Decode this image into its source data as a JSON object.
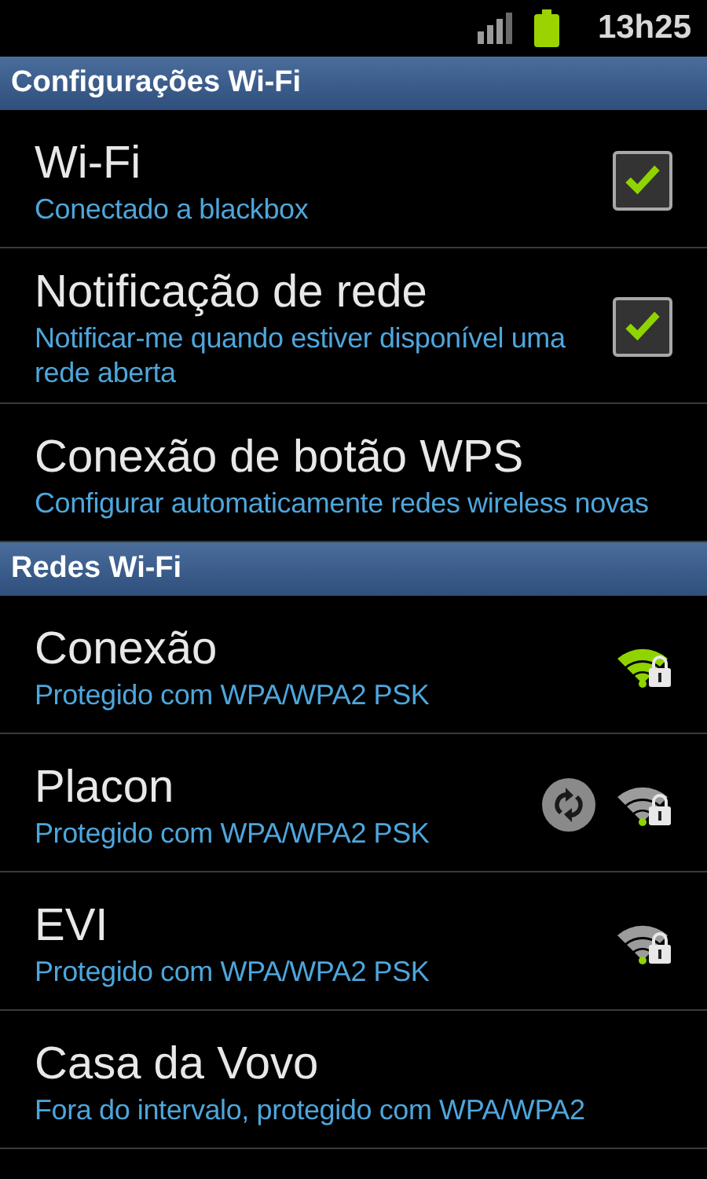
{
  "status_bar": {
    "time": "13h25"
  },
  "sections": [
    {
      "header": "Configurações Wi-Fi",
      "items": [
        {
          "kind": "checkbox",
          "title": "Wi-Fi",
          "summary": "Conectado a blackbox",
          "checked": true
        },
        {
          "kind": "checkbox",
          "title": "Notificação de rede",
          "summary": "Notificar-me quando estiver disponível uma rede aberta",
          "checked": true
        },
        {
          "kind": "plain",
          "title": "Conexão de botão WPS",
          "summary": "Configurar automaticamente redes wireless novas"
        }
      ]
    },
    {
      "header": "Redes Wi-Fi",
      "items": [
        {
          "kind": "network",
          "title": "Conexão",
          "summary": "Protegido com WPA/WPA2 PSK",
          "strong": true,
          "in_range": true,
          "wps": false
        },
        {
          "kind": "network",
          "title": "Placon",
          "summary": "Protegido com WPA/WPA2 PSK",
          "strong": false,
          "in_range": true,
          "wps": true
        },
        {
          "kind": "network",
          "title": "EVI",
          "summary": "Protegido com WPA/WPA2 PSK",
          "strong": false,
          "in_range": true,
          "wps": false
        },
        {
          "kind": "network",
          "title": "Casa da Vovo",
          "summary": "Fora do intervalo, protegido com WPA/WPA2",
          "in_range": false,
          "wps": false
        }
      ]
    }
  ]
}
